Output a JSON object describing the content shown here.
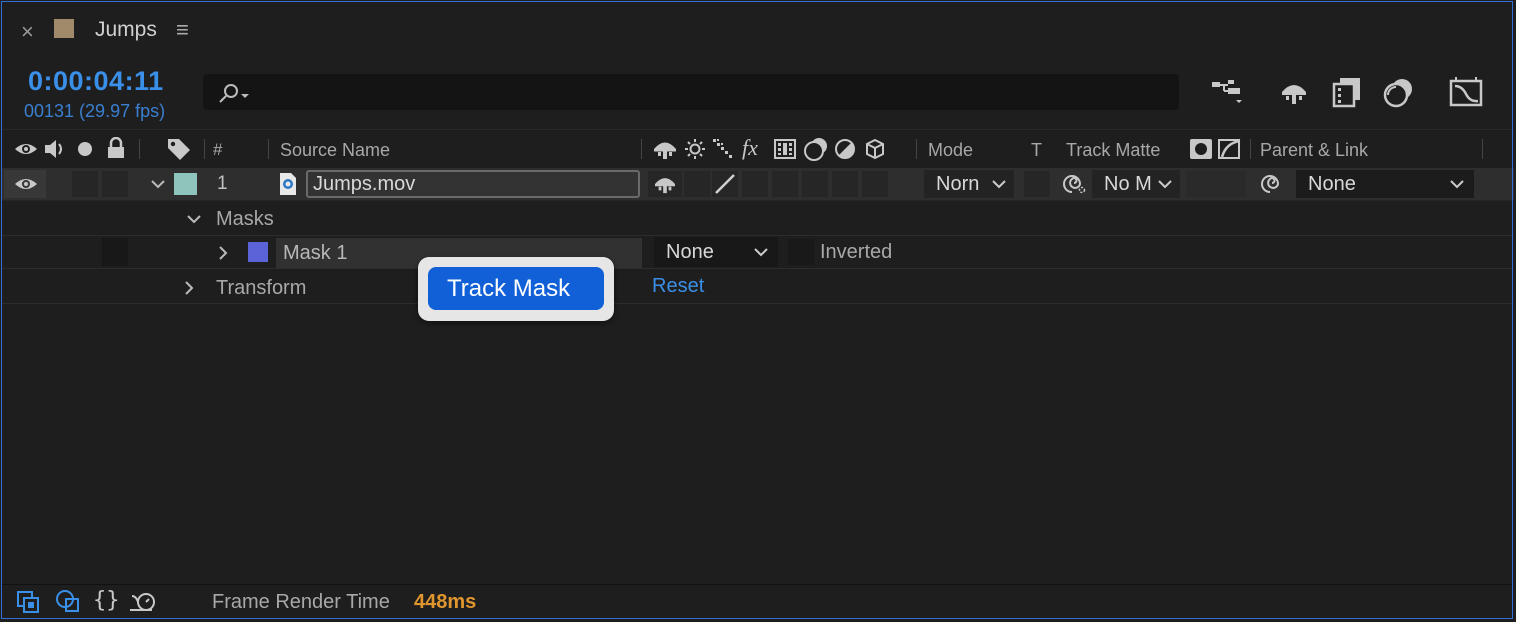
{
  "tab": {
    "close": "×",
    "title": "Jumps",
    "menu": "≡",
    "swatch_color": "#a08a6a"
  },
  "time": {
    "timecode": "0:00:04:11",
    "frames": "00131 (29.97 fps)"
  },
  "search": {
    "placeholder": ""
  },
  "header": {
    "hash": "#",
    "source_name": "Source Name",
    "mode": "Mode",
    "t": "T",
    "track_matte": "Track Matte",
    "parent_link": "Parent & Link"
  },
  "layer": {
    "number": "1",
    "name": "Jumps.mov",
    "label_color": "#8fc4bc",
    "mode": "Norn",
    "track_matte": "No M",
    "parent": "None"
  },
  "masks": {
    "group_label": "Masks",
    "mask1_label": "Mask 1",
    "mask1_color": "#5a63d8",
    "mode": "None",
    "inverted": "Inverted"
  },
  "transform": {
    "label": "Transform",
    "reset": "Reset"
  },
  "tooltip": {
    "label": "Track Mask"
  },
  "footer": {
    "label": "Frame Render Time",
    "value": "448ms"
  },
  "colors": {
    "accent_blue": "#3a8fe8",
    "highlight_orange": "#e0962e",
    "tooltip_blue": "#1160d8"
  }
}
